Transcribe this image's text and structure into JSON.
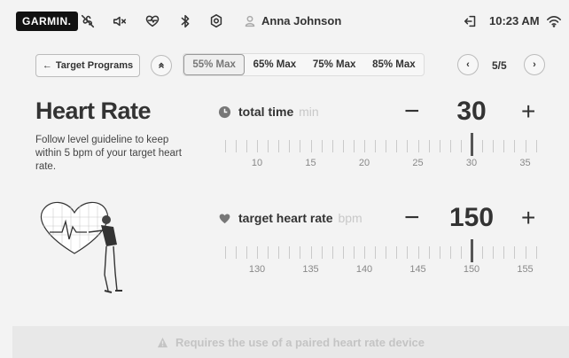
{
  "topbar": {
    "logo": "GARMIN.",
    "icons": [
      "no-fan-icon",
      "speaker-icon",
      "heart-monitor-icon",
      "bluetooth-icon",
      "settings-icon"
    ],
    "user": {
      "icon": "user-icon",
      "name": "Anna Johnson"
    },
    "logout_icon": "logout-icon",
    "time": "10:23 AM",
    "wifi_icon": "wifi-icon"
  },
  "programs": {
    "back_label": "Target Programs",
    "up_icon": "chevron-double-up-icon",
    "tabs": [
      {
        "label": "55% Max",
        "active": true
      },
      {
        "label": "65% Max",
        "active": false
      },
      {
        "label": "75% Max",
        "active": false
      },
      {
        "label": "85% Max",
        "active": false
      }
    ],
    "page_indicator": "5/5"
  },
  "intro": {
    "title": "Heart Rate",
    "description": "Follow level guideline to keep within 5 bpm of your target heart rate."
  },
  "total_time": {
    "label": "total time",
    "unit": "min",
    "value": "30",
    "ticks": [
      "10",
      "15",
      "20",
      "25",
      "30",
      "35"
    ],
    "selected": 30
  },
  "target_hr": {
    "label": "target heart rate",
    "unit": "bpm",
    "value": "150",
    "ticks": [
      "130",
      "135",
      "140",
      "145",
      "150",
      "155"
    ],
    "selected": 150
  },
  "banner": {
    "icon": "warning-icon",
    "text": "Requires the use of a paired heart rate device"
  },
  "colors": {
    "background": "#f3f3f3",
    "text": "#333333",
    "muted": "#c8c8c8",
    "banner": "#e8e8e8"
  }
}
